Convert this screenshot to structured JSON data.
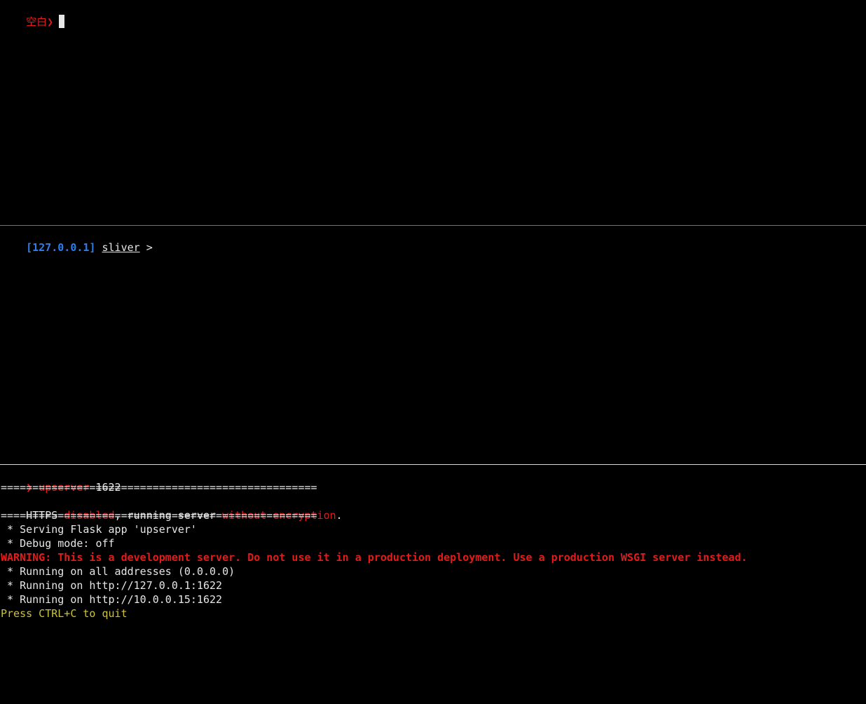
{
  "top_pane": {
    "prompt_label": "空白",
    "prompt_symbol": "❯"
  },
  "middle_pane": {
    "address": "[127.0.0.1]",
    "session_name": "sliver",
    "prompt_symbol": ">"
  },
  "bottom_pane": {
    "prompt_symbol": "❯",
    "command": "upserver",
    "command_arg": "1622",
    "separator": "==================================================",
    "https_prefix": "HTTPS ",
    "https_status": "disabled",
    "https_middle": ", running server ",
    "https_encryption": "without encryption",
    "https_end": ".",
    "serving_line": " * Serving Flask app 'upserver'",
    "debug_line": " * Debug mode: off",
    "warning_line": "WARNING: This is a development server. Do not use it in a production deployment. Use a production WSGI server instead.",
    "running_all": " * Running on all addresses (0.0.0.0)",
    "running_local": " * Running on http://127.0.0.1:1622",
    "running_ip": " * Running on http://10.0.0.15:1622",
    "quit_hint": "Press CTRL+C to quit"
  },
  "colors": {
    "background": "#000000",
    "prompt_red": "#e21b1b",
    "address_blue": "#2f7fe8",
    "hint_yellow": "#cdc23a",
    "pane_divider_purple": "#b040e0",
    "pane_divider_white": "#d8d8d8"
  }
}
